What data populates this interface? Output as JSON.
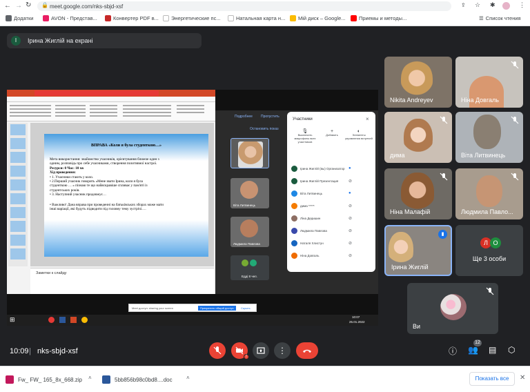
{
  "browser": {
    "url": "meet.google.com/nks-sbjd-xsf",
    "reading_list": "Список чтения",
    "bookmarks": [
      {
        "label": "Додатки",
        "color": "#5f6368"
      },
      {
        "label": "AVON - Представ...",
        "color": "#e91e63"
      },
      {
        "label": "Конвертер PDF в...",
        "color": "#c62828"
      },
      {
        "label": "Энергетические пс...",
        "color": "#9e9e9e"
      },
      {
        "label": "Натальная карта н...",
        "color": "#9e9e9e"
      },
      {
        "label": "Мій диск – Google...",
        "color": "#fbbc04"
      },
      {
        "label": "Приемы и методы...",
        "color": "#ff0000"
      }
    ]
  },
  "presenter_banner": {
    "avatar_letter": "І",
    "text": "Ірина Жиглій на екрані"
  },
  "shared_screen": {
    "ppt_title": "ВПРАВА «Коли я була студенткою…»",
    "ppt_lines": [
      "Мета використання: знайомство учасників, орієнтування ближче один з",
      "одним, розповідь про себе учасниками, створення позитивної настрої.",
      "Ресурси: 0        Час: 10 хв",
      "Хід проведення:",
      "• 1. Учасники стають у коло.",
      "• 2.Перший учасник говорить «Мене звати Ірина, коли я була",
      "студенткою … » пізнаю те що найяскравіше спливає у пам'яті із",
      "студентських років.",
      "• 3. Наступний учасник продовжує…",
      "• Важливо! Дана вправа при проведенні на батьківських зборах може мати",
      "інші варіації, які будуть підводити під головну тему зустрічі…."
    ],
    "notes_label": "Заметки к слайду",
    "share_notice": "Meet доступ: sharing your screen",
    "share_stop": "Прекратить общий доступ",
    "share_hide": "Скрыть",
    "present_link": "Подробнее",
    "present_btn": "Пропустить",
    "tiles": [
      {
        "name": "Віта Литвинець"
      },
      {
        "name": "Людмила Павлова"
      },
      {
        "name": "Едді 8 чел."
      }
    ],
    "participants_panel": {
      "title": "Участники",
      "actions": [
        "Выключить микрофоны всех участников",
        "Добавить",
        "Элементы управления встречей"
      ],
      "people": [
        {
          "name": "Ірина Жиглій (вы) Организатор"
        },
        {
          "name": "Ірина Жиглій Презентация"
        },
        {
          "name": "Віта Литвинець"
        },
        {
          "name": "дима *****"
        },
        {
          "name": "Ліна Дедишин"
        },
        {
          "name": "Людмила Павлова"
        },
        {
          "name": "Наталя Хлистун"
        },
        {
          "name": "Ніна Довгаль"
        }
      ]
    },
    "taskbar_time": "10:07",
    "taskbar_date": "25.01.2022"
  },
  "participants": [
    {
      "name": "Nikita Andreyev",
      "muted": false
    },
    {
      "name": "Ніна Довгаль",
      "muted": true
    },
    {
      "name": "дима",
      "muted": true
    },
    {
      "name": "Віта Литвинець",
      "muted": true
    },
    {
      "name": "Ніна Малафій",
      "muted": true
    },
    {
      "name": "Людмила Павло...",
      "muted": true
    },
    {
      "name": "Ірина Жиглій",
      "muted": false
    },
    {
      "name": "Ще 3 особи",
      "avatars": [
        "Л",
        "О"
      ]
    },
    {
      "name": "Ви",
      "muted": true
    }
  ],
  "bottom_bar": {
    "time": "10:09",
    "separator": "|",
    "meeting_code": "nks-sbjd-xsf",
    "participants_count": "12"
  },
  "downloads": {
    "items": [
      "Fw_ FW_ 165_8x_668.zip",
      "5bb856b98c0bd8....doc"
    ],
    "show_all": "Показать все"
  },
  "colors": {
    "meet_bg": "#202124",
    "tile_bg": "#3c4043",
    "danger": "#ea4335",
    "accent": "#8ab4f8",
    "ppt_red": "#e53935"
  }
}
